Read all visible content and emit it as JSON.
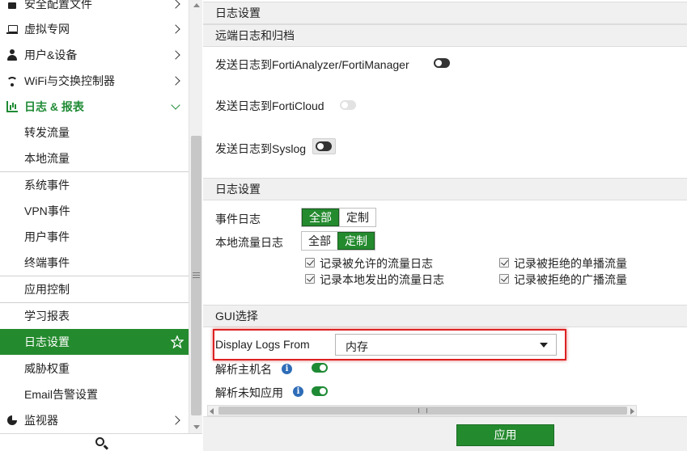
{
  "sidebar": {
    "items": [
      {
        "label": "安全配置文件",
        "icon": "lock-icon"
      },
      {
        "label": "虚拟专网",
        "icon": "laptop-icon"
      },
      {
        "label": "用户&设备",
        "icon": "user-icon"
      },
      {
        "label": "WiFi与交换控制器",
        "icon": "wifi-icon"
      },
      {
        "label": "日志 & 报表",
        "icon": "bar-chart-icon",
        "expanded": true
      },
      {
        "label": "转发流量"
      },
      {
        "label": "本地流量"
      },
      {
        "label": "系统事件"
      },
      {
        "label": "VPN事件"
      },
      {
        "label": "用户事件"
      },
      {
        "label": "终端事件"
      },
      {
        "label": "应用控制"
      },
      {
        "label": "学习报表"
      },
      {
        "label": "日志设置",
        "active": true
      },
      {
        "label": "威胁权重"
      },
      {
        "label": "Email告警设置"
      },
      {
        "label": "监视器",
        "icon": "pie-chart-icon"
      }
    ],
    "search_icon": "search-icon"
  },
  "main": {
    "page_title": "日志设置",
    "remote": {
      "header": "远端日志和归档",
      "fortianalyzer_label": "发送日志到FortiAnalyzer/FortiManager",
      "forticloud_label": "发送日志到FortiCloud",
      "syslog_label": "发送日志到Syslog"
    },
    "log_settings": {
      "header": "日志设置",
      "event_log_label": "事件日志",
      "local_traffic_label": "本地流量日志",
      "opt_all": "全部",
      "opt_custom": "定制",
      "cb_allowed": "记录被允许的流量日志",
      "cb_local_out": "记录本地发出的流量日志",
      "cb_denied_unicast": "记录被拒绝的单播流量",
      "cb_denied_broadcast": "记录被拒绝的广播流量"
    },
    "gui": {
      "header": "GUI选择",
      "display_logs_label": "Display Logs From",
      "display_logs_value": "内存",
      "resolve_host_label": "解析主机名",
      "resolve_app_label": "解析未知应用"
    },
    "apply_label": "应用"
  },
  "colors": {
    "accent_green": "#248a2e",
    "highlight_red": "#dd2222",
    "info_blue": "#2e6cb7"
  }
}
